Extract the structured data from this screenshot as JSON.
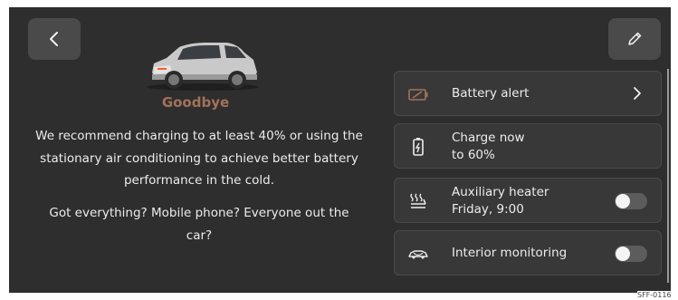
{
  "header": {
    "back_icon": "chevron-left-icon",
    "edit_icon": "pencil-icon"
  },
  "farewell": {
    "title": "Goodbye",
    "message": "We recommend charging to at least 40% or using the stationary air conditioning to achieve better battery performance in the cold.",
    "reminder": "Got everything? Mobile phone? Everyone out the car?"
  },
  "cards": [
    {
      "line1": "Battery alert",
      "line2": "",
      "icon": "battery-alert-icon",
      "control": "chevron"
    },
    {
      "line1": "Charge now",
      "line2": "to 60%",
      "icon": "battery-charge-icon",
      "control": "none"
    },
    {
      "line1": "Auxiliary heater",
      "line2": "Friday, 9:00",
      "icon": "seat-heater-icon",
      "control": "toggle",
      "toggle_on": false
    },
    {
      "line1": "Interior monitoring",
      "line2": "",
      "icon": "car-monitoring-icon",
      "control": "toggle",
      "toggle_on": false
    }
  ],
  "image_code": "SFF-0116",
  "colors": {
    "background": "#2e2e2e",
    "card": "#383838",
    "title_accent": "#a2725a",
    "text": "#ececec"
  }
}
